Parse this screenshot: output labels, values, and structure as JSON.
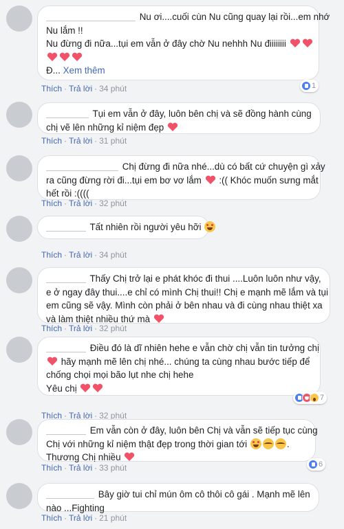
{
  "actions": {
    "like": "Thích",
    "reply": "Trả lời",
    "dot": "·"
  },
  "colors": {
    "link": "#4267b2",
    "heart": "#f25268",
    "bubble_bg": "#ffffff",
    "page_bg": "#f2f3f5"
  },
  "comments": [
    {
      "lines": [
        "Nu ơi....cuối cùn Nu cũng quay lại rồi...em nhớ",
        "Nu lắm !!",
        "Nu đừng đi nữa...tụi em vẫn ở đây chờ Nu nehhh Nu điiiiiiii",
        "",
        "Đ..."
      ],
      "see_more": "Xem thêm",
      "time": "34 phút",
      "reaction_count": "1",
      "reaction_icons": [
        "like-icon"
      ]
    },
    {
      "lines": [
        "Tụi em vẫn ở đây, luôn bên chị và sẽ đồng hành cùng",
        "chị vẽ lên những kỉ niệm đẹp"
      ],
      "time": "31 phút"
    },
    {
      "lines": [
        "Chị đừng đi nữa nhé...dù có bất cứ chuyện gì xảy",
        "ra cũng đừng rời đi...tụi em bơ vơ lắm",
        ":(( Khóc muốn sưng mắt",
        "hết rồi :(((("
      ],
      "time": "32 phút"
    },
    {
      "lines": [
        "Tất nhiên rồi người yêu hỡi"
      ],
      "time": "34 phút"
    },
    {
      "lines": [
        "Thấy Chị trở lại e phát khóc đi thui ....Luôn luôn như vậy,",
        "e ở ngay đây thui....e chỉ có mình Chị thui!! Chị e mạnh mẽ lắm và tụi",
        "em cũng sẽ vậy. Mình còn phải ở bên nhau và đi cùng nhau thiệt xa",
        "và làm thiệt nhiều thứ mà"
      ],
      "time": "32 phút"
    },
    {
      "lines": [
        "Điều đó là dĩ nhiên hehe e vẫn chờ chị vẫn tin tưởng chị",
        "hãy mạnh mẽ lên chị nhé... chúng ta cùng nhau bước tiếp để",
        "chống chọi mọi bão lụt nhe chị hehe",
        "Yêu chị"
      ],
      "time": "32 phút",
      "reaction_count": "7",
      "reaction_icons": [
        "like-icon",
        "love-icon",
        "wow-icon"
      ]
    },
    {
      "lines": [
        "Em vẫn còn ở đây, luôn bên Chị và vẫn sẽ tiếp tục cùng",
        "Chị với những kỉ niệm thật đẹp trong thời gian tới",
        "Thương Chị nhiều"
      ],
      "time": "33 phút",
      "reaction_count": "6",
      "reaction_icons": [
        "like-icon"
      ]
    },
    {
      "lines": [
        "Bây giờ tui chỉ mún ôm cô thôi cô gái . Mạnh mẽ lên",
        "nào ...Fighting"
      ],
      "time": "21 phút"
    }
  ]
}
